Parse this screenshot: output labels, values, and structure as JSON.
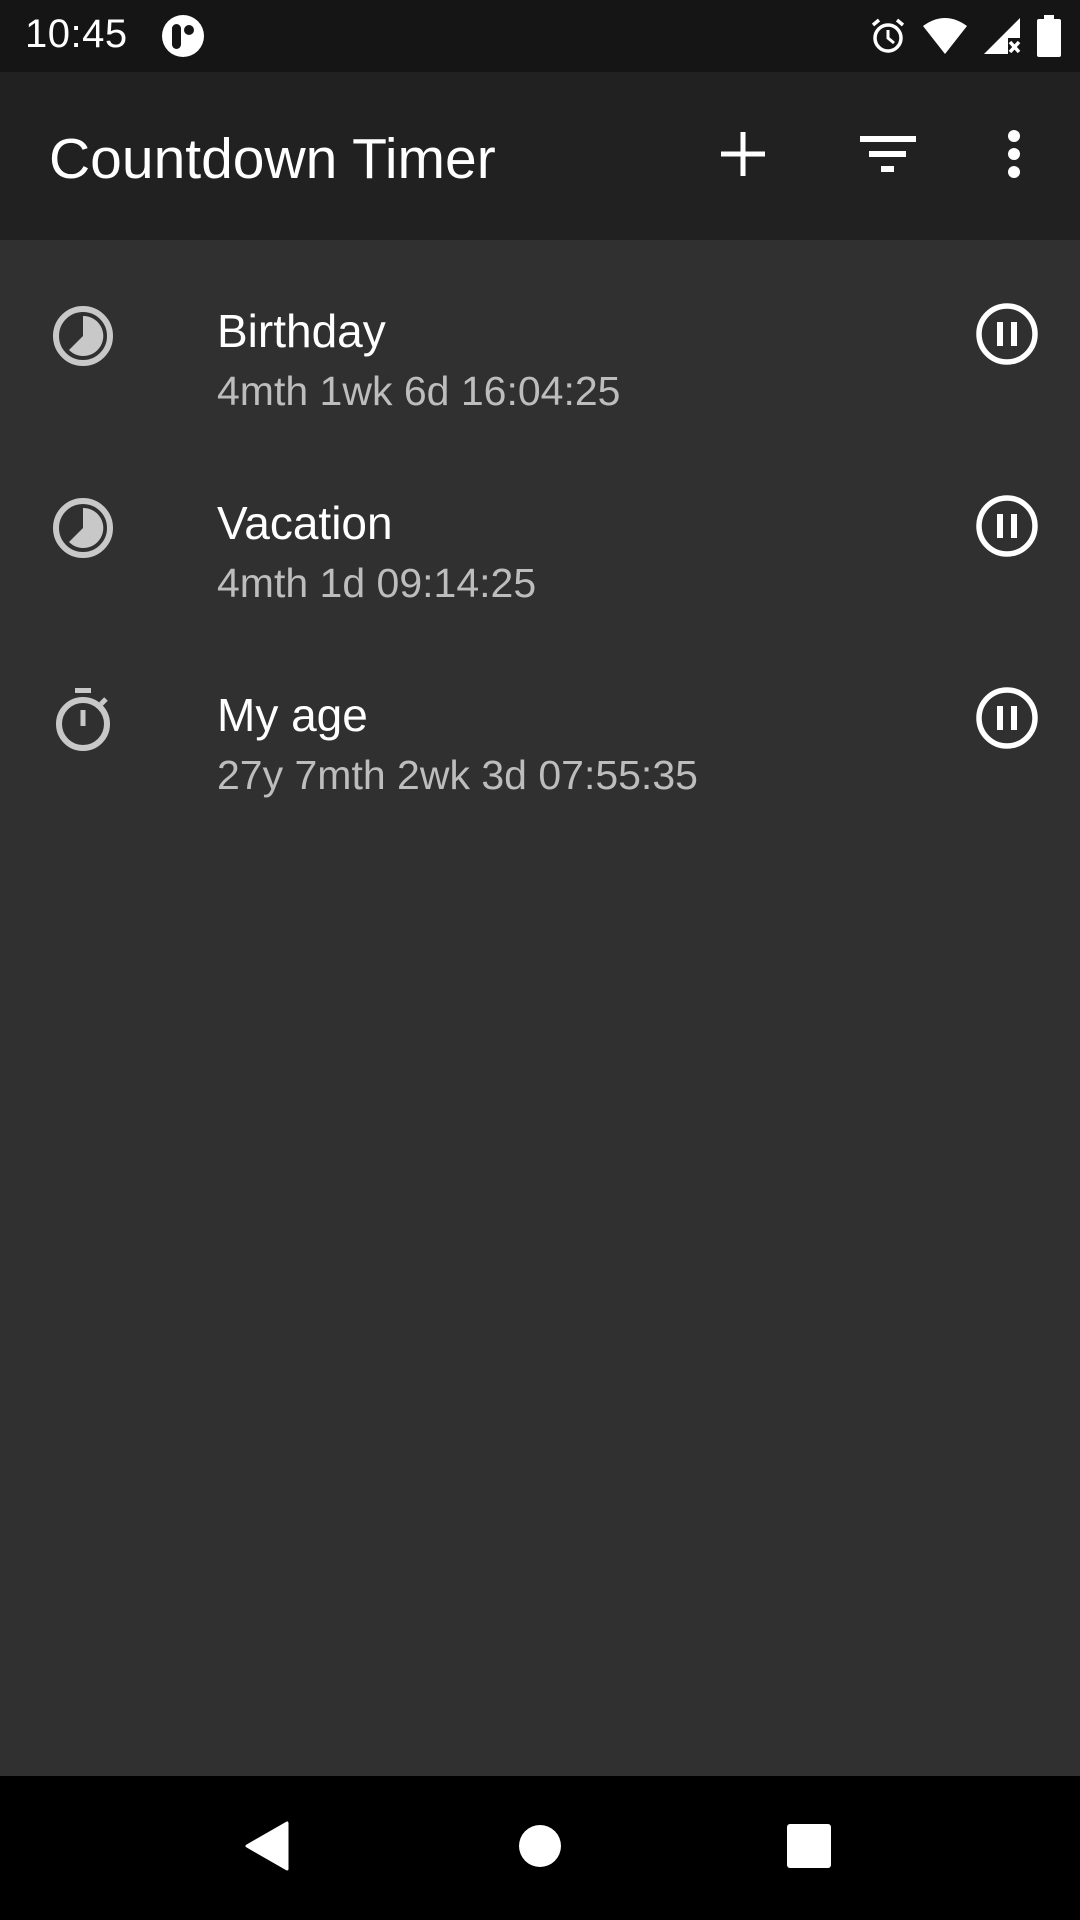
{
  "status_bar": {
    "time": "10:45",
    "icons": [
      "app-notification-icon",
      "alarm-icon",
      "wifi-icon",
      "cell-signal-no-data-icon",
      "battery-icon"
    ]
  },
  "app_bar": {
    "title": "Countdown Timer",
    "actions": [
      {
        "name": "add",
        "icon": "plus-icon"
      },
      {
        "name": "sort-filter",
        "icon": "filter-icon"
      },
      {
        "name": "more-options",
        "icon": "more-vert-icon"
      }
    ]
  },
  "timers": [
    {
      "title": "Birthday",
      "remaining": "4mth 1wk 6d 16:04:25",
      "type_icon": "countdown-clock-icon",
      "action_icon": "pause-circle-icon"
    },
    {
      "title": "Vacation",
      "remaining": "4mth 1d 09:14:25",
      "type_icon": "countdown-clock-icon",
      "action_icon": "pause-circle-icon"
    },
    {
      "title": "My age",
      "remaining": "27y 7mth 2wk 3d 07:55:35",
      "type_icon": "stopwatch-icon",
      "action_icon": "pause-circle-icon"
    }
  ],
  "nav_bar": {
    "buttons": [
      "back",
      "home",
      "recents"
    ]
  },
  "colors": {
    "status_bar_bg": "#151515",
    "app_bar_bg": "#212121",
    "content_bg": "#303030",
    "primary_text": "#ffffff",
    "secondary_text": "#bdbdbd",
    "icon_grey": "#c8c8c8"
  }
}
